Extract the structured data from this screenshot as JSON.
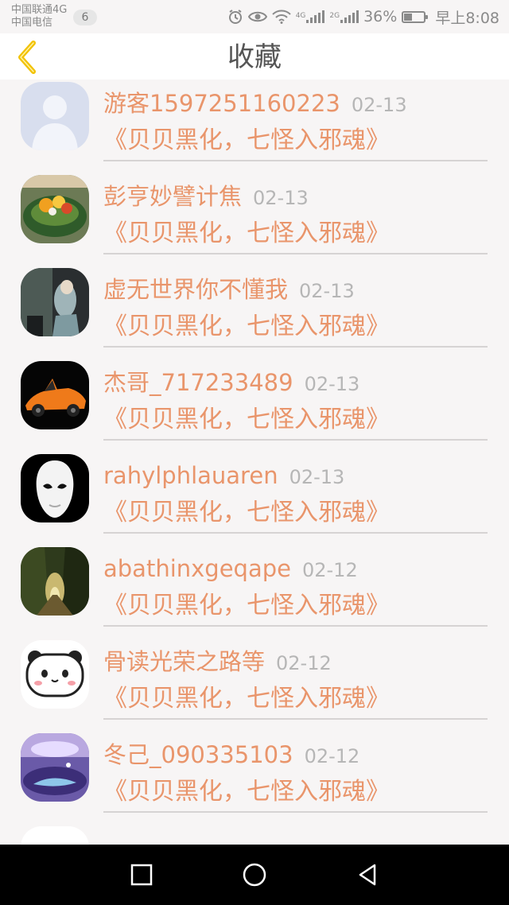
{
  "status_bar": {
    "carrier_1": "中国联通4G",
    "carrier_2": "中国电信",
    "notification_count": "6",
    "network_1": "4G",
    "network_2": "2G",
    "battery_percent": "36%",
    "battery_level": 0.36,
    "time": "早上8:08"
  },
  "header": {
    "title": "收藏"
  },
  "list": {
    "items": [
      {
        "name": "游客1597251160223",
        "date": "02-13",
        "title": "《贝贝黑化，七怪入邪魂》",
        "avatar": "default-avatar"
      },
      {
        "name": "彭亨妙譬计焦",
        "date": "02-13",
        "title": "《贝贝黑化，七怪入邪魂》",
        "avatar": "food-photo"
      },
      {
        "name": "虚无世界你不懂我",
        "date": "02-13",
        "title": "《贝贝黑化，七怪入邪魂》",
        "avatar": "anime-character"
      },
      {
        "name": "杰哥_717233489",
        "date": "02-13",
        "title": "《贝贝黑化，七怪入邪魂》",
        "avatar": "orange-sports-car"
      },
      {
        "name": "rahylphlauaren",
        "date": "02-13",
        "title": "《贝贝黑化，七怪入邪魂》",
        "avatar": "white-mask"
      },
      {
        "name": "abathinxgeqape",
        "date": "02-12",
        "title": "《贝贝黑化，七怪入邪魂》",
        "avatar": "forest-tunnel"
      },
      {
        "name": "骨读光荣之路等",
        "date": "02-12",
        "title": "《贝贝黑化，七怪入邪魂》",
        "avatar": "cartoon-panda"
      },
      {
        "name": "冬己_090335103",
        "date": "02-12",
        "title": "《贝贝黑化，七怪入邪魂》",
        "avatar": "purple-fantasy"
      }
    ]
  },
  "colors": {
    "accent": "#e9956b",
    "date": "#b6b6b6",
    "back_arrow": "#f2c200",
    "title": "#555555"
  },
  "bottom_nav": {
    "icons": [
      "square-icon",
      "circle-icon",
      "triangle-back-icon"
    ]
  }
}
